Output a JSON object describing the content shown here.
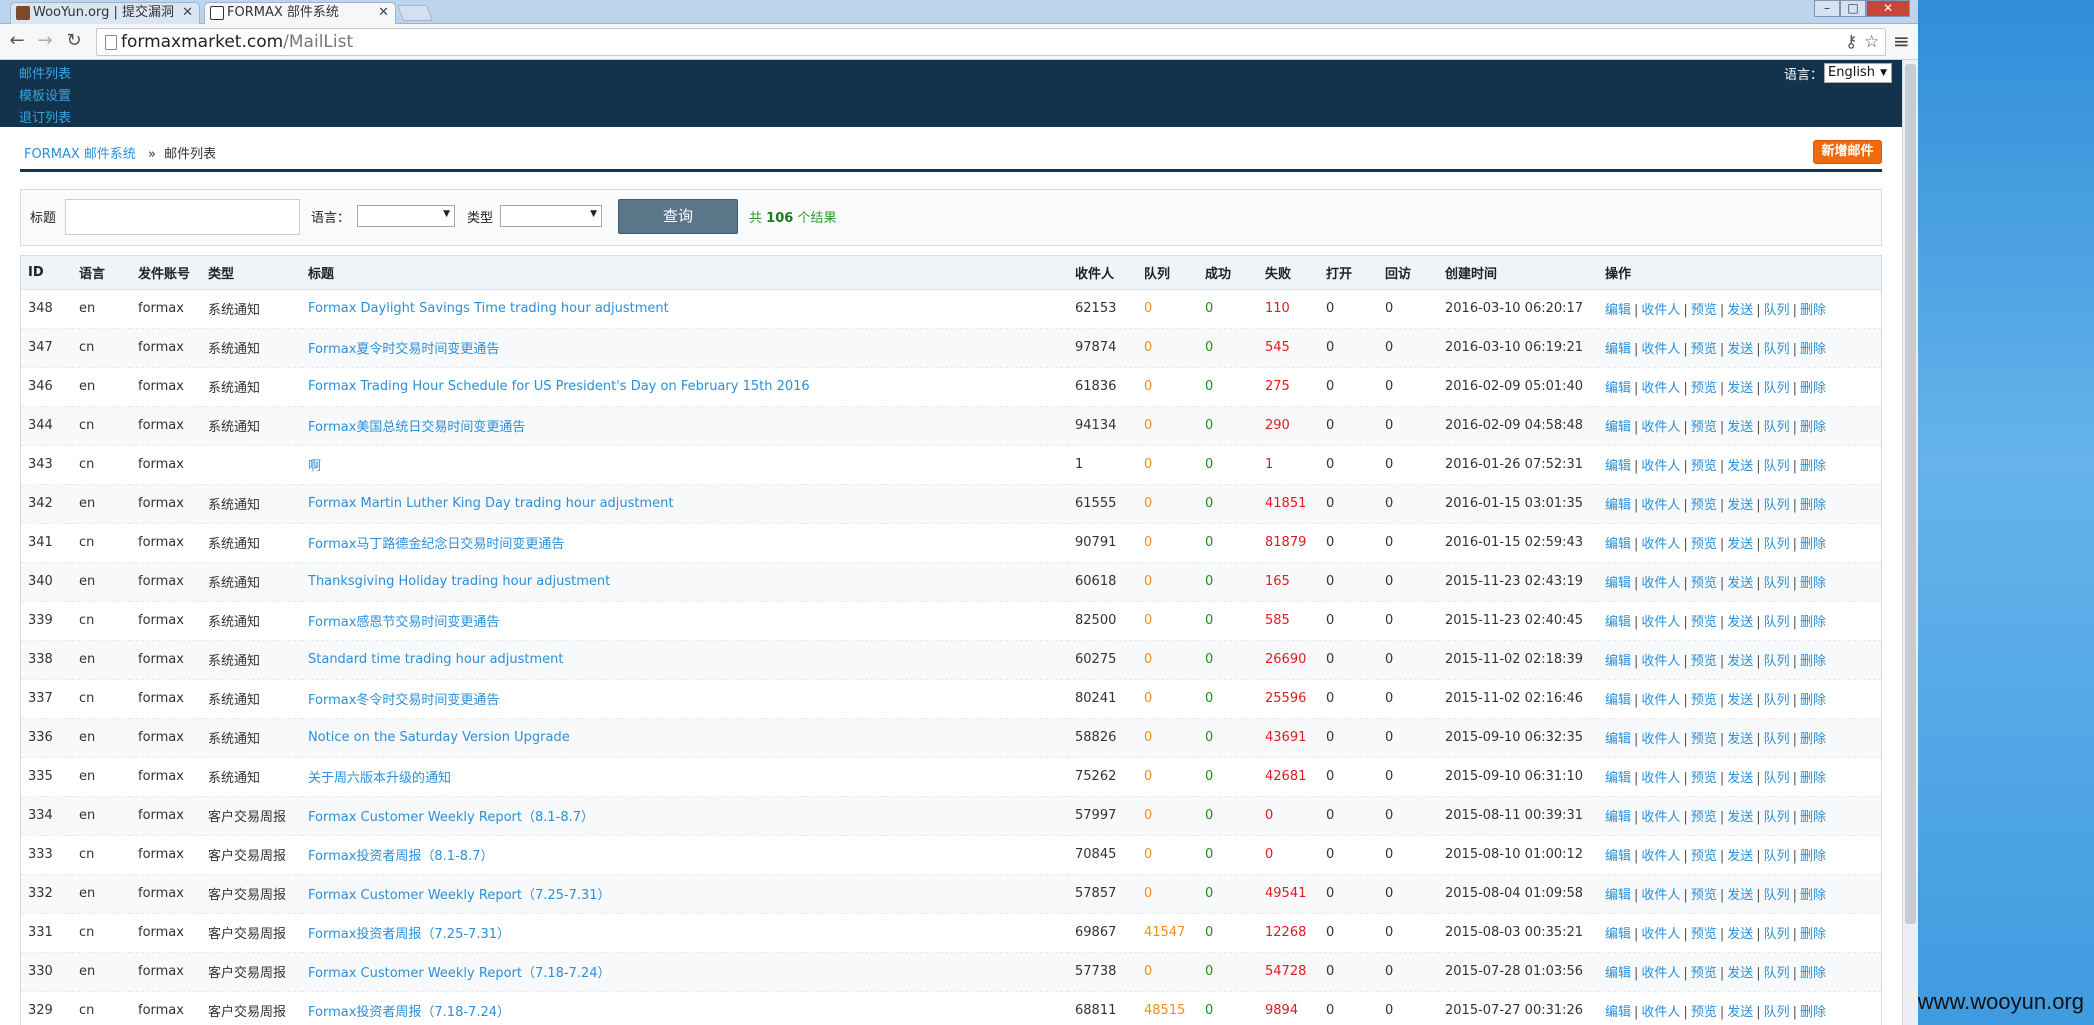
{
  "browser": {
    "tabs": [
      {
        "title": "WooYun.org | 提交漏洞",
        "active": false
      },
      {
        "title": "FORMAX 部件系统",
        "active": true
      }
    ],
    "url_host": "formaxmarket.com",
    "url_path": "/MailList"
  },
  "header": {
    "nav": [
      "邮件列表",
      "模板设置",
      "退订列表"
    ],
    "language_label": "语言：",
    "language_value": "English"
  },
  "breadcrumb": {
    "root": "FORMAX 邮件系统",
    "separator": "»",
    "current": "邮件列表"
  },
  "new_mail_button": "新增邮件",
  "filter": {
    "title_label": "标题",
    "title_value": "",
    "language_label": "语言：",
    "language_value": "",
    "type_label": "类型",
    "type_value": "",
    "query_button": "查询",
    "result_prefix": "共",
    "result_count": "106",
    "result_suffix": "个结果"
  },
  "table": {
    "headers": [
      "ID",
      "语言",
      "发件账号",
      "类型",
      "标题",
      "收件人",
      "队列",
      "成功",
      "失败",
      "打开",
      "回访",
      "创建时间",
      "操作"
    ],
    "operations": [
      "编辑",
      "收件人",
      "预览",
      "发送",
      "队列",
      "删除"
    ],
    "rows": [
      {
        "id": "348",
        "lang": "en",
        "account": "formax",
        "type": "系统通知",
        "title": "Formax Daylight Savings Time trading hour adjustment",
        "recipients": "62153",
        "queue": "0",
        "success": "0",
        "fail": "110",
        "open": "0",
        "revisit": "0",
        "created": "2016-03-10 06:20:17"
      },
      {
        "id": "347",
        "lang": "cn",
        "account": "formax",
        "type": "系统通知",
        "title": "Formax夏令时交易时间变更通告",
        "recipients": "97874",
        "queue": "0",
        "success": "0",
        "fail": "545",
        "open": "0",
        "revisit": "0",
        "created": "2016-03-10 06:19:21"
      },
      {
        "id": "346",
        "lang": "en",
        "account": "formax",
        "type": "系统通知",
        "title": "Formax Trading Hour Schedule for US President's Day on February 15th 2016",
        "recipients": "61836",
        "queue": "0",
        "success": "0",
        "fail": "275",
        "open": "0",
        "revisit": "0",
        "created": "2016-02-09 05:01:40"
      },
      {
        "id": "344",
        "lang": "cn",
        "account": "formax",
        "type": "系统通知",
        "title": "Formax美国总统日交易时间变更通告",
        "recipients": "94134",
        "queue": "0",
        "success": "0",
        "fail": "290",
        "open": "0",
        "revisit": "0",
        "created": "2016-02-09 04:58:48"
      },
      {
        "id": "343",
        "lang": "cn",
        "account": "formax",
        "type": "",
        "title": "啊",
        "recipients": "1",
        "queue": "0",
        "success": "0",
        "fail": "1",
        "open": "0",
        "revisit": "0",
        "created": "2016-01-26 07:52:31"
      },
      {
        "id": "342",
        "lang": "en",
        "account": "formax",
        "type": "系统通知",
        "title": "Formax Martin Luther King Day trading hour adjustment",
        "recipients": "61555",
        "queue": "0",
        "success": "0",
        "fail": "41851",
        "open": "0",
        "revisit": "0",
        "created": "2016-01-15 03:01:35"
      },
      {
        "id": "341",
        "lang": "cn",
        "account": "formax",
        "type": "系统通知",
        "title": "Formax马丁路德金纪念日交易时间变更通告",
        "recipients": "90791",
        "queue": "0",
        "success": "0",
        "fail": "81879",
        "open": "0",
        "revisit": "0",
        "created": "2016-01-15 02:59:43"
      },
      {
        "id": "340",
        "lang": "en",
        "account": "formax",
        "type": "系统通知",
        "title": "Thanksgiving Holiday trading hour adjustment",
        "recipients": "60618",
        "queue": "0",
        "success": "0",
        "fail": "165",
        "open": "0",
        "revisit": "0",
        "created": "2015-11-23 02:43:19"
      },
      {
        "id": "339",
        "lang": "cn",
        "account": "formax",
        "type": "系统通知",
        "title": "Formax感恩节交易时间变更通告",
        "recipients": "82500",
        "queue": "0",
        "success": "0",
        "fail": "585",
        "open": "0",
        "revisit": "0",
        "created": "2015-11-23 02:40:45"
      },
      {
        "id": "338",
        "lang": "en",
        "account": "formax",
        "type": "系统通知",
        "title": "Standard time trading hour adjustment",
        "recipients": "60275",
        "queue": "0",
        "success": "0",
        "fail": "26690",
        "open": "0",
        "revisit": "0",
        "created": "2015-11-02 02:18:39"
      },
      {
        "id": "337",
        "lang": "cn",
        "account": "formax",
        "type": "系统通知",
        "title": "Formax冬令时交易时间变更通告",
        "recipients": "80241",
        "queue": "0",
        "success": "0",
        "fail": "25596",
        "open": "0",
        "revisit": "0",
        "created": "2015-11-02 02:16:46"
      },
      {
        "id": "336",
        "lang": "en",
        "account": "formax",
        "type": "系统通知",
        "title": "Notice on the Saturday Version Upgrade",
        "recipients": "58826",
        "queue": "0",
        "success": "0",
        "fail": "43691",
        "open": "0",
        "revisit": "0",
        "created": "2015-09-10 06:32:35"
      },
      {
        "id": "335",
        "lang": "en",
        "account": "formax",
        "type": "系统通知",
        "title": "关于周六版本升级的通知",
        "recipients": "75262",
        "queue": "0",
        "success": "0",
        "fail": "42681",
        "open": "0",
        "revisit": "0",
        "created": "2015-09-10 06:31:10"
      },
      {
        "id": "334",
        "lang": "en",
        "account": "formax",
        "type": "客户交易周报",
        "title": "Formax Customer Weekly Report（8.1-8.7）",
        "recipients": "57997",
        "queue": "0",
        "success": "0",
        "fail": "0",
        "open": "0",
        "revisit": "0",
        "created": "2015-08-11 00:39:31"
      },
      {
        "id": "333",
        "lang": "cn",
        "account": "formax",
        "type": "客户交易周报",
        "title": "Formax投资者周报（8.1-8.7）",
        "recipients": "70845",
        "queue": "0",
        "success": "0",
        "fail": "0",
        "open": "0",
        "revisit": "0",
        "created": "2015-08-10 01:00:12"
      },
      {
        "id": "332",
        "lang": "en",
        "account": "formax",
        "type": "客户交易周报",
        "title": "Formax Customer Weekly Report（7.25-7.31）",
        "recipients": "57857",
        "queue": "0",
        "success": "0",
        "fail": "49541",
        "open": "0",
        "revisit": "0",
        "created": "2015-08-04 01:09:58"
      },
      {
        "id": "331",
        "lang": "cn",
        "account": "formax",
        "type": "客户交易周报",
        "title": "Formax投资者周报（7.25-7.31）",
        "recipients": "69867",
        "queue": "41547",
        "success": "0",
        "fail": "12268",
        "open": "0",
        "revisit": "0",
        "created": "2015-08-03 00:35:21"
      },
      {
        "id": "330",
        "lang": "en",
        "account": "formax",
        "type": "客户交易周报",
        "title": "Formax Customer Weekly Report（7.18-7.24）",
        "recipients": "57738",
        "queue": "0",
        "success": "0",
        "fail": "54728",
        "open": "0",
        "revisit": "0",
        "created": "2015-07-28 01:03:56"
      },
      {
        "id": "329",
        "lang": "cn",
        "account": "formax",
        "type": "客户交易周报",
        "title": "Formax投资者周报（7.18-7.24）",
        "recipients": "68811",
        "queue": "48515",
        "success": "0",
        "fail": "9894",
        "open": "0",
        "revisit": "0",
        "created": "2015-07-27 00:31:26"
      }
    ]
  },
  "watermark": "www.wooyun.org",
  "colors": {
    "header_bg": "#13334d",
    "link": "#2b90d9",
    "new_button": "#f06a0f",
    "query_button": "#5b7689",
    "queue": "#f28c1c",
    "success": "#1a8f1a",
    "fail": "#e2191d"
  }
}
